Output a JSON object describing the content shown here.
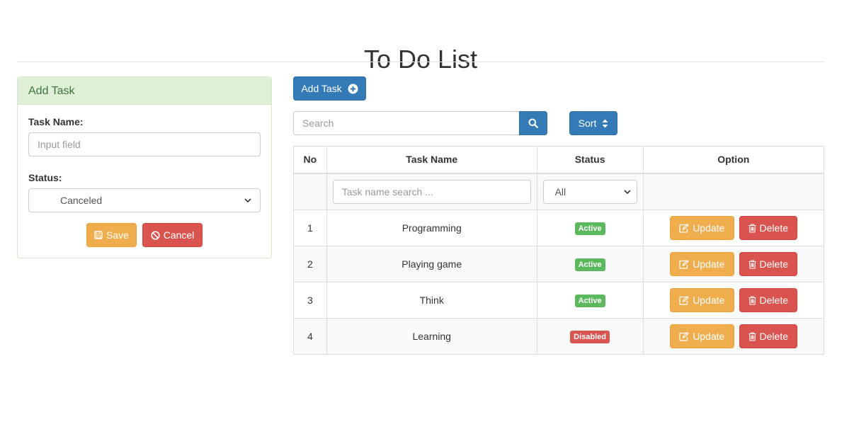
{
  "page": {
    "title": "To Do List"
  },
  "add_panel": {
    "heading": "Add Task",
    "task_name_label": "Task Name:",
    "task_name_placeholder": "Input field",
    "status_label": "Status:",
    "status_selected": "Canceled",
    "save_label": "Save",
    "cancel_label": "Cancel"
  },
  "toolbar": {
    "add_task_label": "Add Task",
    "search_placeholder": "Search",
    "sort_label": "Sort"
  },
  "table": {
    "headers": [
      "No",
      "Task Name",
      "Status",
      "Option"
    ],
    "filter": {
      "name_placeholder": "Task name search ...",
      "status_selected": "All"
    },
    "rows": [
      {
        "no": "1",
        "name": "Programming",
        "status": "Active",
        "update": "Update",
        "delete": "Delete"
      },
      {
        "no": "2",
        "name": "Playing game",
        "status": "Active",
        "update": "Update",
        "delete": "Delete"
      },
      {
        "no": "3",
        "name": "Think",
        "status": "Active",
        "update": "Update",
        "delete": "Delete"
      },
      {
        "no": "4",
        "name": "Learning",
        "status": "Disabled",
        "update": "Update",
        "delete": "Delete"
      }
    ]
  },
  "icons": {
    "add": "plus-circle-icon",
    "search": "search-icon",
    "sort": "sort-icon",
    "save": "floppy-disk-icon",
    "cancel": "ban-icon",
    "update": "edit-icon",
    "delete": "trash-icon"
  },
  "colors": {
    "primary": "#337ab7",
    "warning": "#f0ad4e",
    "danger": "#d9534f",
    "success": "#5cb85c",
    "panel_heading_bg": "#dff0d8",
    "panel_heading_text": "#3c763d"
  }
}
